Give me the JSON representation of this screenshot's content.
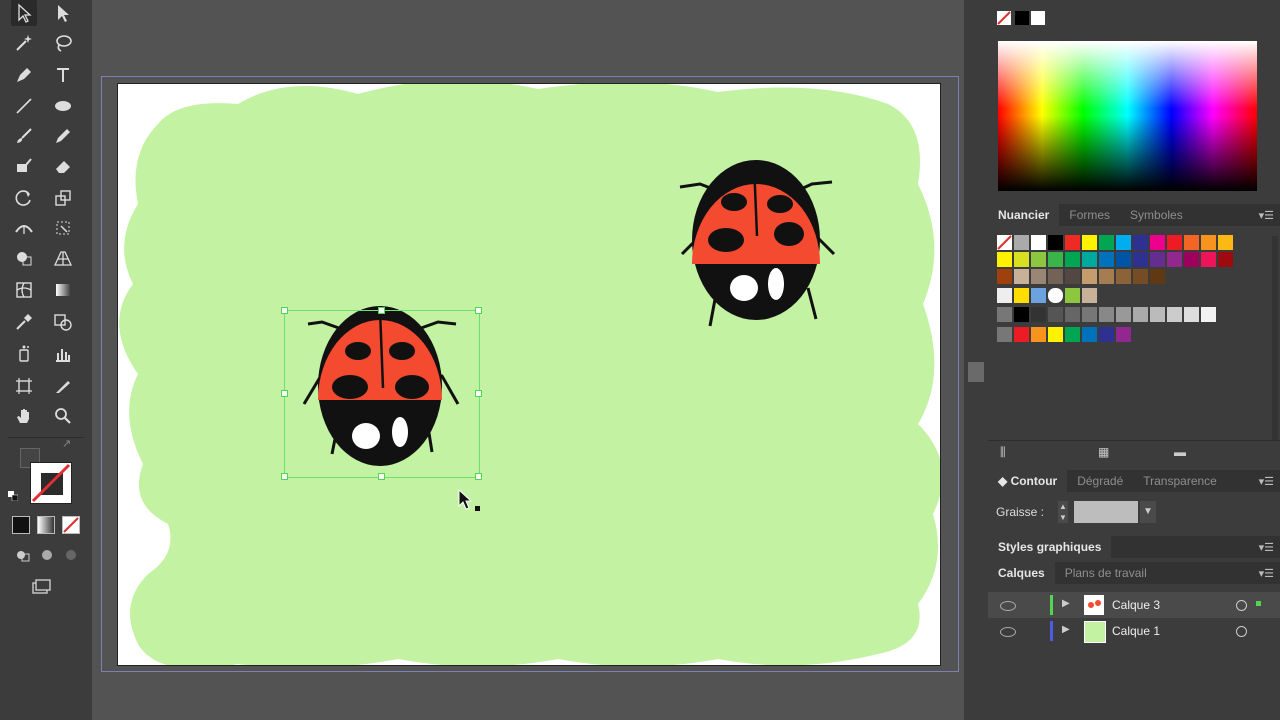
{
  "colors": {
    "accent": "#4d8be8",
    "green_bg": "#c3f2a3",
    "ladybug_red": "#f44a2f"
  },
  "swatches_panel": {
    "tabs": [
      "Nuancier",
      "Formes",
      "Symboles"
    ]
  },
  "stroke_panel": {
    "tabs": [
      "Contour",
      "Dégradé",
      "Transparence"
    ],
    "weight_label": "Graisse :",
    "weight_value": ""
  },
  "graphic_styles": {
    "title": "Styles graphiques"
  },
  "layers_panel": {
    "tabs": [
      "Calques",
      "Plans de travail"
    ],
    "layers": [
      {
        "name": "Calque 3",
        "color": "#4fd84f",
        "selected": true
      },
      {
        "name": "Calque 1",
        "color": "#4d5be8",
        "selected": false
      }
    ]
  },
  "tools": [
    "selection-tool",
    "direct-selection-tool",
    "magic-wand-tool",
    "lasso-tool",
    "pen-tool",
    "type-tool",
    "line-tool",
    "ellipse-tool",
    "paintbrush-tool",
    "pencil-tool",
    "blob-brush-tool",
    "eraser-tool",
    "rotate-tool",
    "scale-tool",
    "width-tool",
    "free-transform-tool",
    "shape-builder-tool",
    "perspective-grid-tool",
    "mesh-tool",
    "gradient-tool",
    "eyedropper-tool",
    "blend-tool",
    "symbol-sprayer-tool",
    "column-graph-tool",
    "artboard-tool",
    "slice-tool",
    "hand-tool",
    "zoom-tool"
  ]
}
